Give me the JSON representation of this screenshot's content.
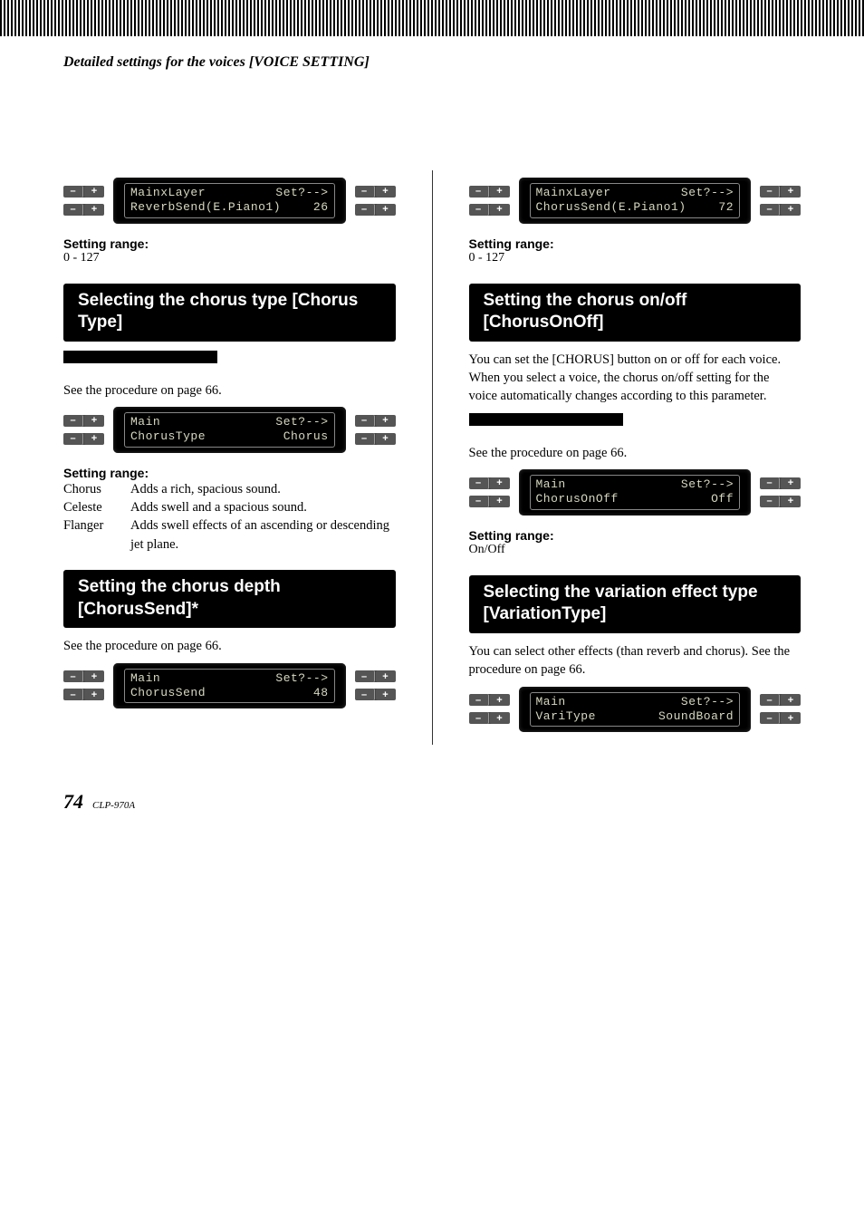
{
  "header": "Detailed settings for the voices [VOICE SETTING]",
  "left": {
    "lcd1": {
      "l1a": "MainxLayer",
      "l1b": "Set?-->",
      "l2a": "ReverbSend(E.Piano1)",
      "l2b": "26"
    },
    "range1_label": "Setting range:",
    "range1_value": "0 - 127",
    "h1": "Selecting the chorus type [Chorus Type]",
    "see1": "See the procedure on page 66.",
    "lcd2": {
      "l1a": "Main",
      "l1b": "Set?-->",
      "l2a": "ChorusType",
      "l2b": "Chorus"
    },
    "range2_label": "Setting range:",
    "range2": [
      {
        "k": "Chorus",
        "v": "Adds a rich, spacious sound."
      },
      {
        "k": "Celeste",
        "v": "Adds swell and a spacious sound."
      },
      {
        "k": "Flanger",
        "v": "Adds swell effects of an ascending or descending jet plane."
      }
    ],
    "h2": "Setting the chorus depth [ChorusSend]*",
    "see2": "See the procedure on page 66.",
    "lcd3": {
      "l1a": "Main",
      "l1b": "Set?-->",
      "l2a": "ChorusSend",
      "l2b": "48"
    }
  },
  "right": {
    "lcd1": {
      "l1a": "MainxLayer",
      "l1b": "Set?-->",
      "l2a": "ChorusSend(E.Piano1)",
      "l2b": "72"
    },
    "range1_label": "Setting range:",
    "range1_value": "0 - 127",
    "h1": "Setting the chorus on/off [ChorusOnOff]",
    "body1": "You can set the [CHORUS] button on or off for each voice. When you select a voice, the chorus on/off setting for the voice automatically changes according to this parameter.",
    "see1": "See the procedure on page 66.",
    "lcd2": {
      "l1a": "Main",
      "l1b": "Set?-->",
      "l2a": "ChorusOnOff",
      "l2b": "Off"
    },
    "range2_label": "Setting range:",
    "range2_value": "On/Off",
    "h2": "Selecting the variation effect type [VariationType]",
    "body2": "You can select other effects (than reverb and chorus). See the procedure on page 66.",
    "lcd3": {
      "l1a": "Main",
      "l1b": "Set?-->",
      "l2a": "VariType",
      "l2b": "SoundBoard"
    }
  },
  "footer": {
    "page": "74",
    "model": "CLP-970A"
  },
  "glyphs": {
    "minus": "–",
    "plus": "+"
  }
}
